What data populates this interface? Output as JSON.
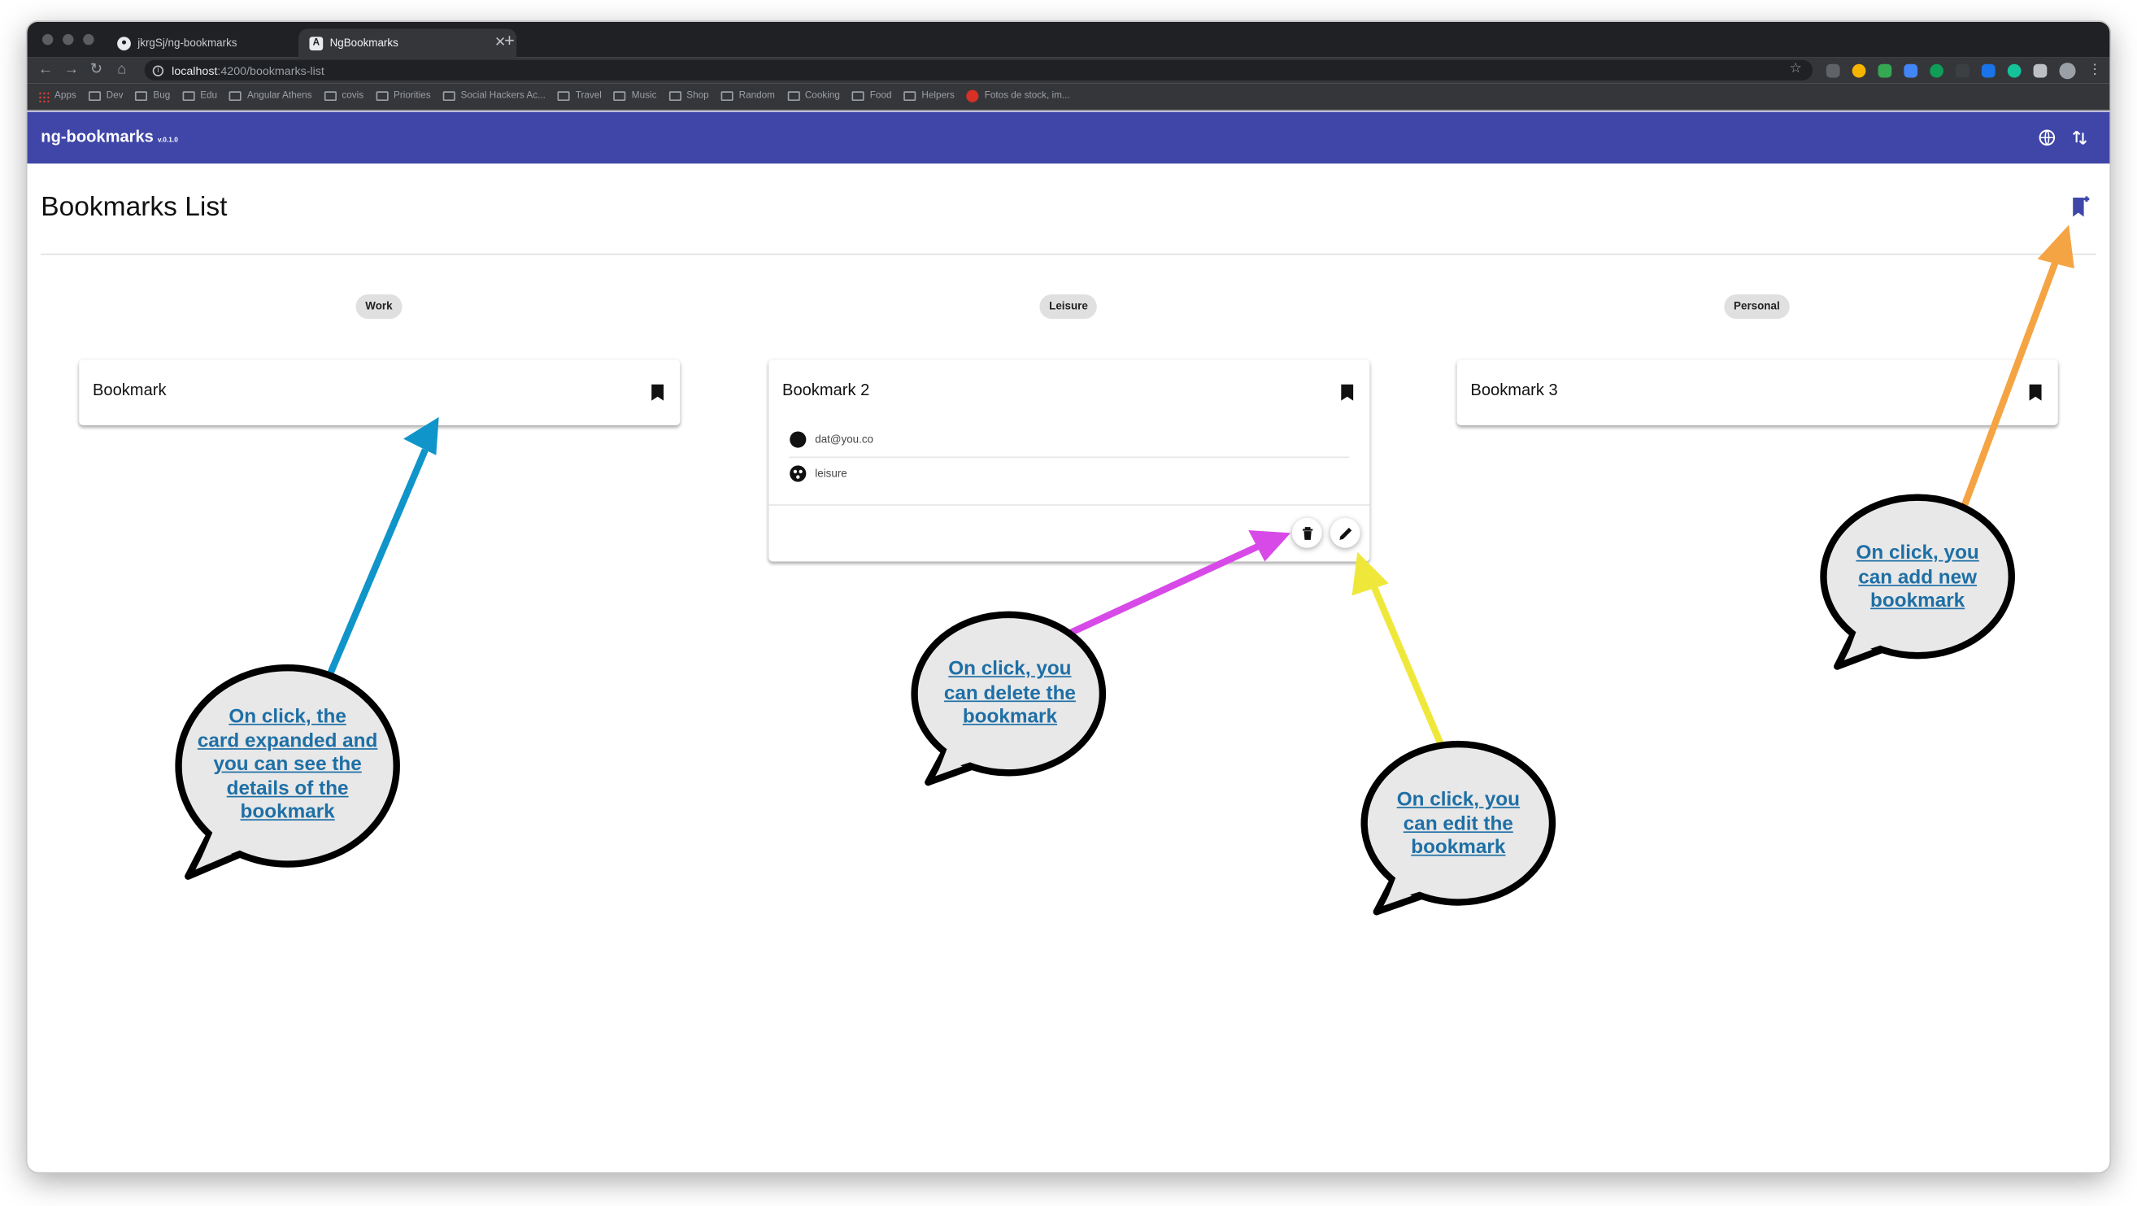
{
  "browser": {
    "tabs": [
      {
        "title": "jkrgSj/ng-bookmarks",
        "active": false,
        "icon": "github-icon"
      },
      {
        "title": "NgBookmarks",
        "active": true,
        "icon": "angular-icon"
      }
    ],
    "address": {
      "host": "localhost",
      "path": ":4200/bookmarks-list"
    },
    "bookmarks_bar": [
      "Apps",
      "Dev",
      "Bug",
      "Edu",
      "Angular Athens",
      "covis",
      "Priorities",
      "Social Hackers Ac...",
      "Travel",
      "Music",
      "Shop",
      "Random",
      "Cooking",
      "Food",
      "Helpers",
      "Fotos de stock, im..."
    ]
  },
  "app": {
    "title": "ng-bookmarks",
    "version": "v.0.1.0",
    "accent_color": "#3f46a8",
    "toolbar_icons": [
      "language-icon",
      "sort-icon"
    ]
  },
  "page": {
    "title": "Bookmarks List",
    "add_icon": "add-bookmark-icon"
  },
  "groups": [
    {
      "label": "Work",
      "card_title": "Bookmark",
      "expanded": false
    },
    {
      "label": "Leisure",
      "card_title": "Bookmark 2",
      "expanded": true,
      "fields": [
        {
          "icon": "account-circle-icon",
          "value": "dat@you.co"
        },
        {
          "icon": "category-icon",
          "value": "leisure"
        }
      ],
      "actions": [
        "delete-icon",
        "edit-icon"
      ]
    },
    {
      "label": "Personal",
      "card_title": "Bookmark 3",
      "expanded": false
    }
  ],
  "annotations": [
    {
      "lines": [
        "On click, the",
        "card expanded and",
        "you can see the",
        "details of the",
        "bookmark"
      ],
      "color": "#0f95c9"
    },
    {
      "lines": [
        "On click, you",
        "can delete the",
        "bookmark"
      ],
      "color": "#d84ae8"
    },
    {
      "lines": [
        "On click, you",
        "can edit the",
        "bookmark"
      ],
      "color": "#efe83a"
    },
    {
      "lines": [
        "On click, you",
        "can add new",
        "bookmark"
      ],
      "color": "#f5a443"
    }
  ]
}
